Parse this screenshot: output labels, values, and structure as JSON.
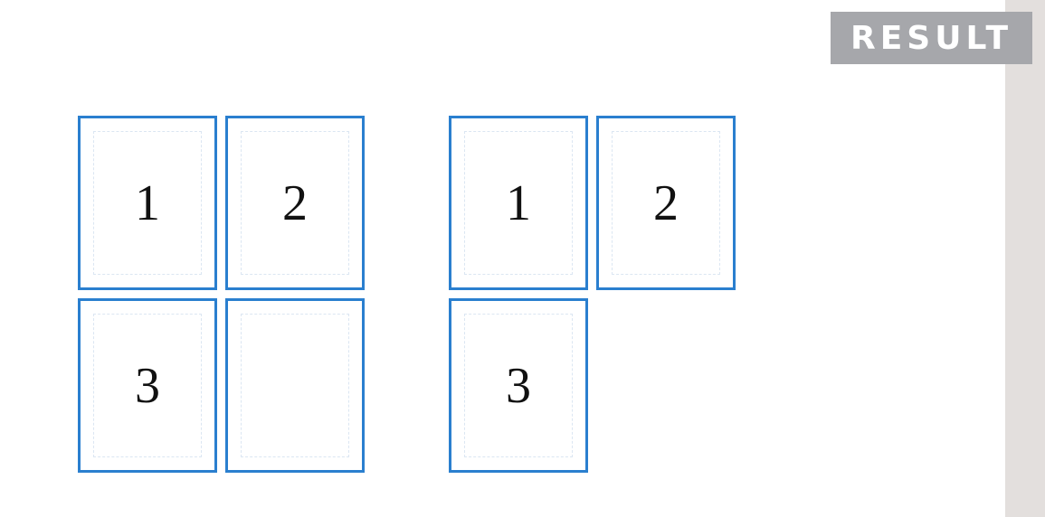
{
  "badge": {
    "label": "RESULT"
  },
  "left_layout": {
    "pages": [
      "1",
      "2",
      "3",
      ""
    ]
  },
  "right_layout": {
    "pages": [
      "1",
      "2",
      "3"
    ]
  },
  "colors": {
    "border": "#2a7fcf",
    "badge": "#a6a7ab",
    "strip": "#e3dfdd"
  }
}
